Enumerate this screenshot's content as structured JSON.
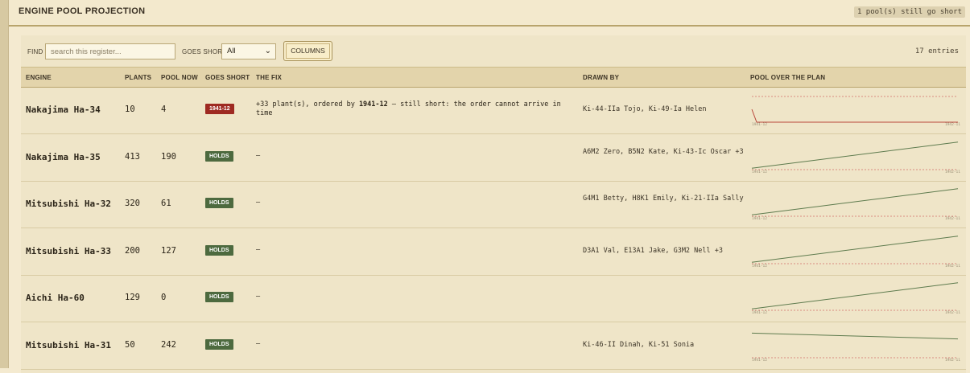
{
  "header": {
    "title": "ENGINE POOL PROJECTION",
    "status": "1 pool(s) still go short"
  },
  "toolbar": {
    "find_label": "FIND",
    "search_placeholder": "search this register...",
    "goes_short_label": "GOES SHORT",
    "goes_short_value": "All",
    "columns_label": "COLUMNS",
    "entries": "17 entries"
  },
  "columns": [
    "ENGINE",
    "PLANTS",
    "POOL NOW",
    "GOES SHORT",
    "THE FIX",
    "DRAWN BY",
    "POOL OVER THE PLAN"
  ],
  "colors": {
    "short": "#9e2a22",
    "holds": "#4d6a3f",
    "line_short": "#b8463a",
    "line_ok": "#5e7b4e",
    "zero_line": "#d98a80"
  },
  "spark_labels": {
    "start": "1941-12",
    "end": "1942-11"
  },
  "rows": [
    {
      "engine": "Nakajima Ha-34",
      "plants": "10",
      "pool_now": "4",
      "goes_short": "1941-12",
      "short": true,
      "fix_pre": "+33 plant(s), ordered by ",
      "fix_bold": "1941-12",
      "fix_post": " — still short: the order cannot arrive in time",
      "drawn_by": "Ki-44-IIa Tojo, Ki-49-Ia Helen"
    },
    {
      "engine": "Nakajima Ha-35",
      "plants": "413",
      "pool_now": "190",
      "goes_short": "HOLDS",
      "short": false,
      "fix_pre": "—",
      "fix_bold": "",
      "fix_post": "",
      "drawn_by": "A6M2 Zero, B5N2 Kate, Ki-43-Ic Oscar +3"
    },
    {
      "engine": "Mitsubishi Ha-32",
      "plants": "320",
      "pool_now": "61",
      "goes_short": "HOLDS",
      "short": false,
      "fix_pre": "—",
      "fix_bold": "",
      "fix_post": "",
      "drawn_by": "G4M1 Betty, H8K1 Emily, Ki-21-IIa Sally"
    },
    {
      "engine": "Mitsubishi Ha-33",
      "plants": "200",
      "pool_now": "127",
      "goes_short": "HOLDS",
      "short": false,
      "fix_pre": "—",
      "fix_bold": "",
      "fix_post": "",
      "drawn_by": "D3A1 Val, E13A1 Jake, G3M2 Nell +3"
    },
    {
      "engine": "Aichi Ha-60",
      "plants": "129",
      "pool_now": "0",
      "goes_short": "HOLDS",
      "short": false,
      "fix_pre": "—",
      "fix_bold": "",
      "fix_post": "",
      "drawn_by": ""
    },
    {
      "engine": "Mitsubishi Ha-31",
      "plants": "50",
      "pool_now": "242",
      "goes_short": "HOLDS",
      "short": false,
      "fix_pre": "—",
      "fix_bold": "",
      "fix_post": "",
      "drawn_by": "Ki-46-II Dinah, Ki-51 Sonia"
    }
  ]
}
